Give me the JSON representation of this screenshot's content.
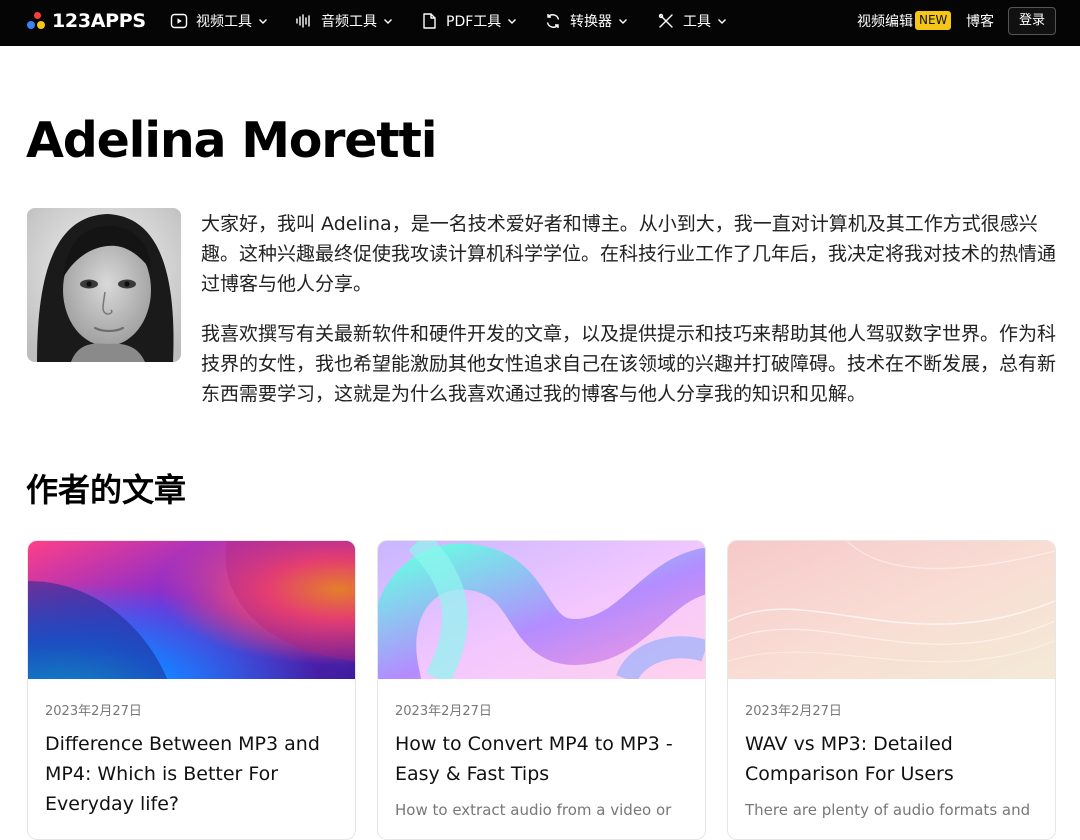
{
  "header": {
    "logo_text": "123APPS",
    "nav": [
      {
        "label": "视频工具",
        "icon": "play-icon"
      },
      {
        "label": "音频工具",
        "icon": "waveform-icon"
      },
      {
        "label": "PDF工具",
        "icon": "document-icon"
      },
      {
        "label": "转换器",
        "icon": "convert-icon"
      },
      {
        "label": "工具",
        "icon": "tools-icon"
      }
    ],
    "video_editor_label": "视频编辑",
    "new_badge": "NEW",
    "blog_label": "博客",
    "login_label": "登录"
  },
  "author": {
    "name": "Adelina Moretti",
    "bio": [
      "大家好，我叫 Adelina，是一名技术爱好者和博主。从小到大，我一直对计算机及其工作方式很感兴趣。这种兴趣最终促使我攻读计算机科学学位。在科技行业工作了几年后，我决定将我对技术的热情通过博客与他人分享。",
      "我喜欢撰写有关最新软件和硬件开发的文章，以及提供提示和技巧来帮助其他人驾驭数字世界。作为科技界的女性，我也希望能激励其他女性追求自己在该领域的兴趣并打破障碍。技术在不断发展，总有新东西需要学习，这就是为什么我喜欢通过我的博客与他人分享我的知识和见解。"
    ]
  },
  "articles_section_title": "作者的文章",
  "articles": [
    {
      "date": "2023年2月27日",
      "title": "Difference Between MP3 and MP4: Which is Better For Everyday life?",
      "excerpt": ""
    },
    {
      "date": "2023年2月27日",
      "title": "How to Convert MP4 to MP3 - Easy & Fast Tips",
      "excerpt": "How to extract audio from a video or"
    },
    {
      "date": "2023年2月27日",
      "title": "WAV vs MP3: Detailed Comparison For Users",
      "excerpt": "There are plenty of audio formats and"
    }
  ],
  "colors": {
    "header_bg": "#050505",
    "badge_bg": "#f5c518",
    "logo_dot_1": "#ff3d3d",
    "logo_dot_2": "#3b82f6",
    "logo_dot_3": "#f5c518"
  }
}
